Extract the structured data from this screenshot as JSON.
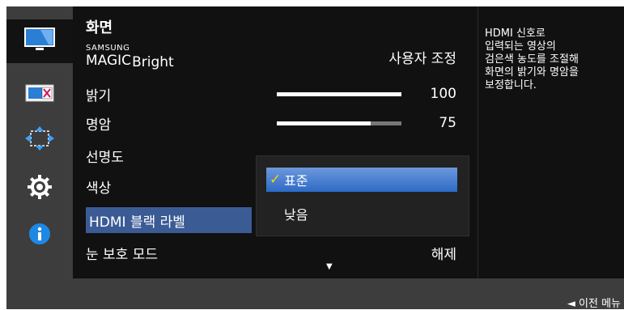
{
  "sidebar": {
    "items": [
      {
        "icon": "picture-icon"
      },
      {
        "icon": "screen-adjust-icon"
      },
      {
        "icon": "position-icon"
      },
      {
        "icon": "settings-gear-icon"
      },
      {
        "icon": "info-icon"
      }
    ]
  },
  "menu": {
    "title": "화면",
    "rows": [
      {
        "label_small": "SAMSUNG",
        "label_large": "MAGIC",
        "label_suffix": "Bright",
        "value": "사용자 조정"
      },
      {
        "label": "밝기",
        "value": "100",
        "level": 1.0
      },
      {
        "label": "명암",
        "value": "75",
        "level": 0.75
      },
      {
        "label": "선명도"
      },
      {
        "label": "색상"
      },
      {
        "label": "HDMI 블랙 라벨"
      },
      {
        "label": "눈 보호 모드",
        "value": "해제"
      }
    ],
    "scroll_arrow": "▼"
  },
  "dropdown": {
    "options": [
      {
        "label": "표준",
        "selected": true,
        "check": "✓"
      },
      {
        "label": "낮음",
        "selected": false
      }
    ]
  },
  "help": {
    "text": "HDMI 신호로\n입력되는 영상의\n검은색 농도를 조절해\n화면의 밝기와 명암을\n보정합니다."
  },
  "footer": {
    "back_label": "◄  이전 메뉴"
  },
  "colors": {
    "selected_row": "#3b5b95",
    "dropdown_selected": "#2c6ac6",
    "check": "#ffd400",
    "info": "#1e88e5"
  }
}
